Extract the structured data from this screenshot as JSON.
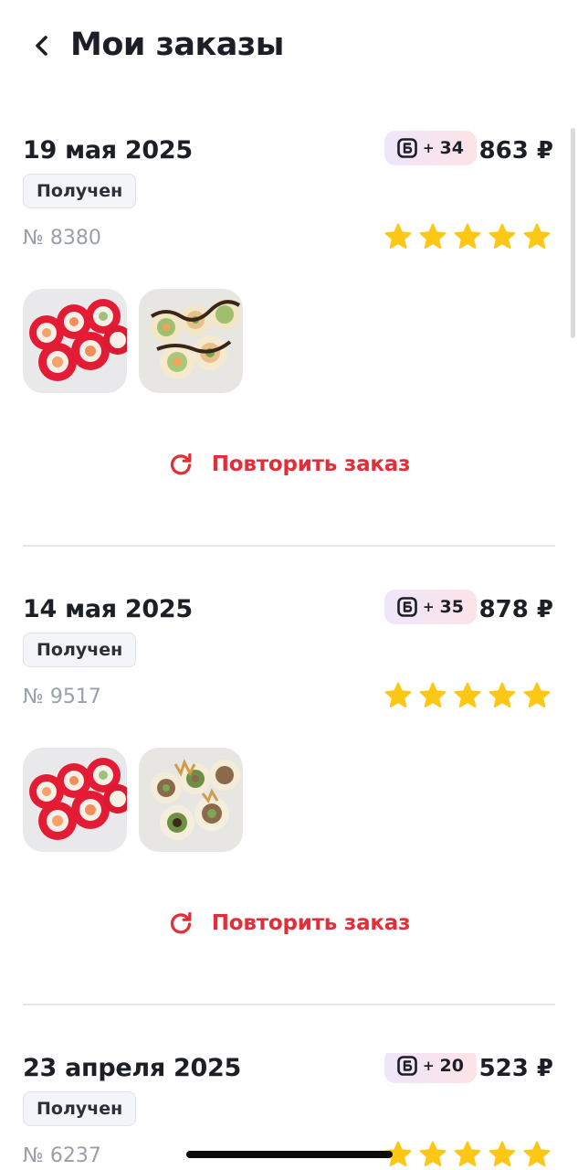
{
  "header": {
    "title": "Мои заказы"
  },
  "orders": [
    {
      "date": "19 мая 2025",
      "bonus_plus": "+",
      "bonus_value": "34",
      "price": "863 ₽",
      "status": "Получен",
      "number": "№ 8380",
      "rating": 5,
      "repeat_label": "Повторить заказ",
      "items": [
        "roll-red-tobiko",
        "roll-cheese-sauce"
      ]
    },
    {
      "date": "14 мая 2025",
      "bonus_plus": "+",
      "bonus_value": "35",
      "price": "878 ₽",
      "status": "Получен",
      "number": "№ 9517",
      "rating": 5,
      "repeat_label": "Повторить заказ",
      "items": [
        "roll-red-tobiko",
        "roll-crispy-onion"
      ]
    },
    {
      "date": "23 апреля 2025",
      "bonus_plus": "+",
      "bonus_value": "20",
      "price": "523 ₽",
      "status": "Получен",
      "number": "№ 6237",
      "rating": 5
    }
  ],
  "colors": {
    "accent": "#e12f3a",
    "star": "#fdc716",
    "text": "#1c2026",
    "muted": "#9aa0a8"
  },
  "icons": {
    "back": "chevron-left-icon",
    "bonus": "bonus-b-icon",
    "star": "star-icon",
    "repeat": "refresh-icon"
  }
}
